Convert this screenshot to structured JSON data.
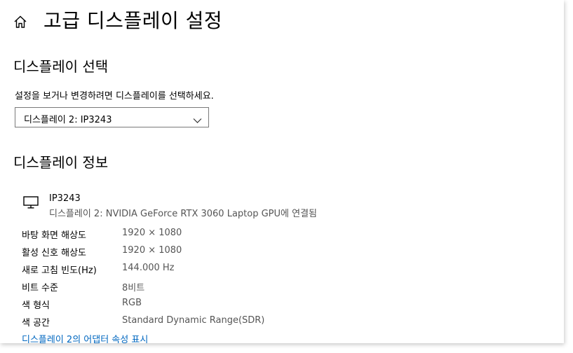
{
  "header": {
    "title": "고급 디스플레이 설정",
    "home_icon": "home-icon"
  },
  "select_display": {
    "heading": "디스플레이 선택",
    "instruction": "설정을 보거나 변경하려면 디스플레이를 선택하세요.",
    "dropdown_value": "디스플레이 2: IP3243",
    "dropdown_icon": "chevron-down-icon"
  },
  "display_info": {
    "heading": "디스플레이 정보",
    "monitor_icon": "monitor-icon",
    "name": "IP3243",
    "connection": "디스플레이 2: NVIDIA GeForce RTX 3060 Laptop GPU에 연결됨",
    "rows": [
      {
        "label": "바탕 화면 해상도",
        "value": "1920 × 1080"
      },
      {
        "label": "활성 신호 해상도",
        "value": "1920 × 1080"
      },
      {
        "label": "새로 고침 빈도(Hz)",
        "value": "144.000 Hz"
      },
      {
        "label": "비트 수준",
        "value": "8비트"
      },
      {
        "label": "색 형식",
        "value": "RGB"
      },
      {
        "label": "색 공간",
        "value": "Standard Dynamic Range(SDR)"
      }
    ],
    "adapter_link": "디스플레이 2의 어댑터 속성 표시"
  },
  "colors": {
    "link": "#0067c0",
    "secondary_text": "#555555",
    "dropdown_border": "#7a7a7a"
  }
}
